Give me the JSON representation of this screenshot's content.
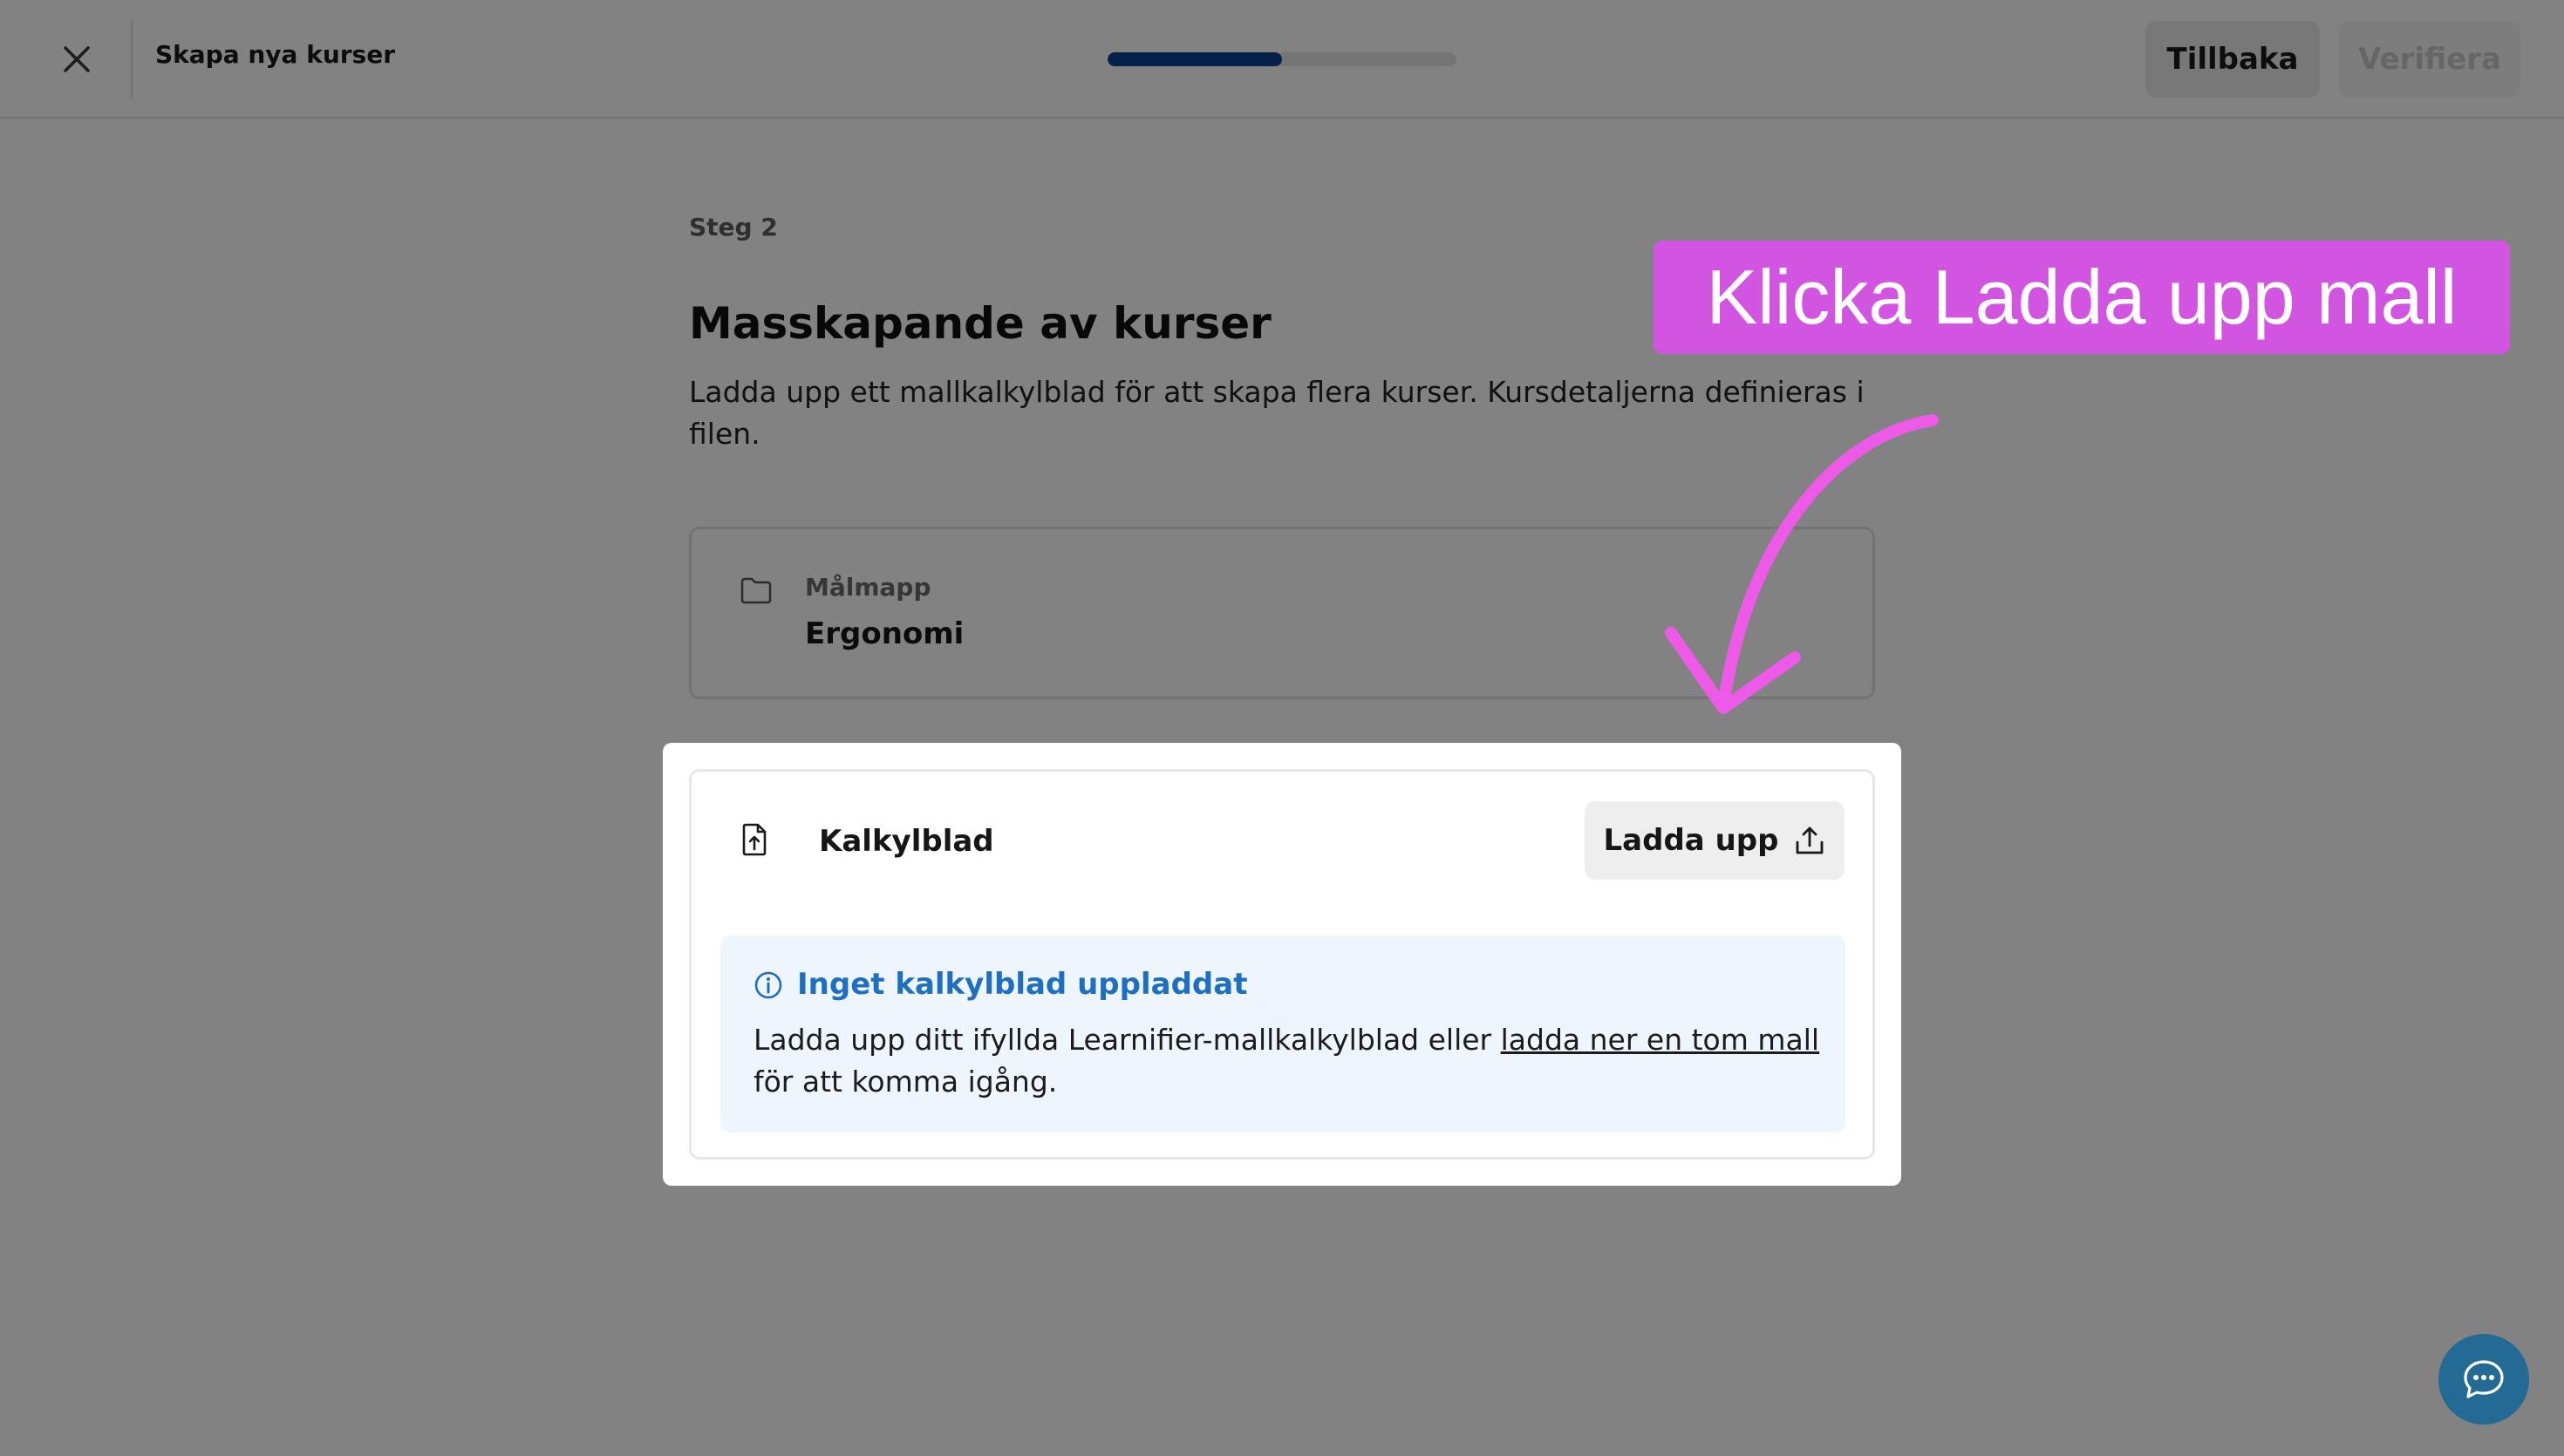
{
  "topbar": {
    "title": "Skapa nya kurser",
    "progress_fraction": 0.5,
    "back_label": "Tillbaka",
    "verify_label": "Verifiera"
  },
  "content": {
    "step": "Steg 2",
    "title": "Masskapande av kurser",
    "description": "Ladda upp ett mallkalkylblad för att skapa flera kurser. Kursdetaljerna definieras i filen.",
    "folder": {
      "label": "Målmapp",
      "value": "Ergonomi"
    },
    "spreadsheet": {
      "label": "Kalkylblad",
      "upload_label": "Ladda upp",
      "info_title": "Inget kalkylblad uppladdat",
      "info_text_before": "Ladda upp ditt ifyllda Learnifier-mallkalkylblad eller ",
      "info_link": "ladda ner en tom mall",
      "info_text_after": " för att komma igång."
    }
  },
  "annotation": {
    "callout_text": "Klicka Ladda upp mall"
  },
  "colors": {
    "progress_fill": "#0a3f8f",
    "callout": "#d155e0",
    "arrow": "#ee5ae8",
    "info_title": "#1e6fc0",
    "chat_button": "#236a94"
  },
  "icons": {
    "close": "close-icon",
    "folder": "folder-icon",
    "spreadsheet": "file-upload-icon",
    "upload": "upload-icon",
    "info": "info-icon",
    "chat": "chat-bubble-icon"
  }
}
